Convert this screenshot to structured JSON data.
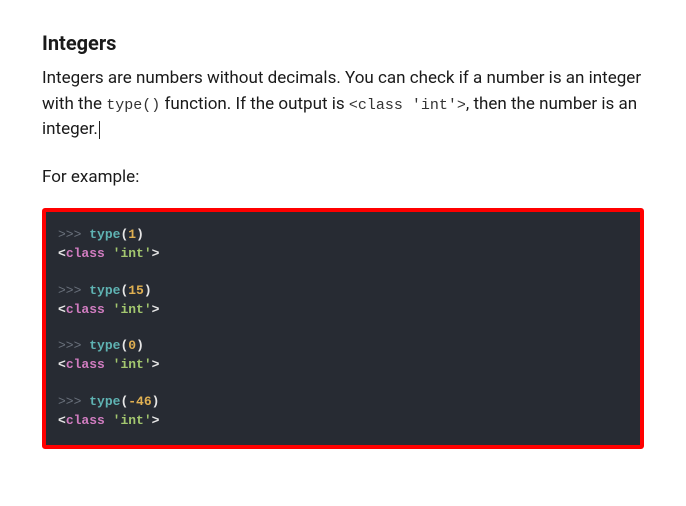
{
  "heading": "Integers",
  "paragraph": {
    "part1": "Integers are numbers without decimals. You can check if a number is an integer with the ",
    "code1": "type()",
    "part2": " function. If the output is ",
    "code2": "<class 'int'>",
    "part3": ", then the number is an integer."
  },
  "example_label": "For example:",
  "code": {
    "prompt": ">>>",
    "type_kw": "type",
    "open": "(",
    "close": ")",
    "lt": "<",
    "gt": ">",
    "class_kw": "class",
    "int_str": "'int'",
    "examples": [
      {
        "val": "1"
      },
      {
        "val": "15"
      },
      {
        "val": "0"
      },
      {
        "val": "-46"
      }
    ]
  }
}
